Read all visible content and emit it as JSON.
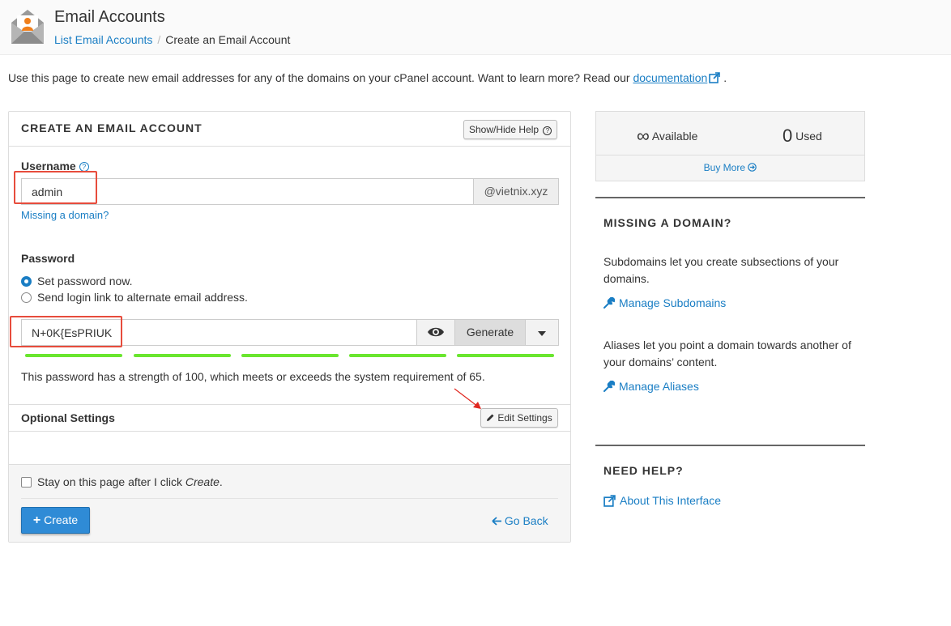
{
  "header": {
    "title": "Email Accounts",
    "breadcrumb_link": "List Email Accounts",
    "breadcrumb_separator": "/",
    "breadcrumb_current": "Create an Email Account"
  },
  "intro": {
    "text": "Use this page to create new email addresses for any of the domains on your cPanel account. Want to learn more? Read our",
    "link": "documentation",
    "end": "."
  },
  "form": {
    "title": "CREATE AN EMAIL ACCOUNT",
    "help_button": "Show/Hide Help",
    "username_label": "Username",
    "username_value": "admin",
    "domain": "@vietnix.xyz",
    "missing_domain_link": "Missing a domain?",
    "password_label": "Password",
    "radio_set_now": "Set password now.",
    "radio_send_link": "Send login link to alternate email address.",
    "password_value": "N+0K{EsPRIUK",
    "generate_button": "Generate",
    "strength_percent": 100,
    "strength_text": "This password has a strength of 100, which meets or exceeds the system requirement of 65.",
    "optional_title": "Optional Settings",
    "edit_settings_button": "Edit Settings",
    "stay_text": "Stay on this page after I click",
    "stay_emph": "Create",
    "stay_end": ".",
    "create_button": "Create",
    "go_back": "Go Back"
  },
  "stats": {
    "available_value": "∞",
    "available_label": "Available",
    "used_value": "0",
    "used_label": "Used",
    "buy_more": "Buy More"
  },
  "sidebar": {
    "missing_title": "MISSING A DOMAIN?",
    "subdomains_text": "Subdomains let you create subsections of your domains.",
    "manage_subdomains": "Manage Subdomains",
    "aliases_text": "Aliases let you point a domain towards another of your domains’ content.",
    "manage_aliases": "Manage Aliases",
    "help_title": "NEED HELP?",
    "about_link": "About This Interface"
  },
  "colors": {
    "accent": "#1a7ec4",
    "primary_button": "#2f8bd6",
    "strength_bar": "#6ae62f",
    "highlight_box": "#e74c3c"
  }
}
